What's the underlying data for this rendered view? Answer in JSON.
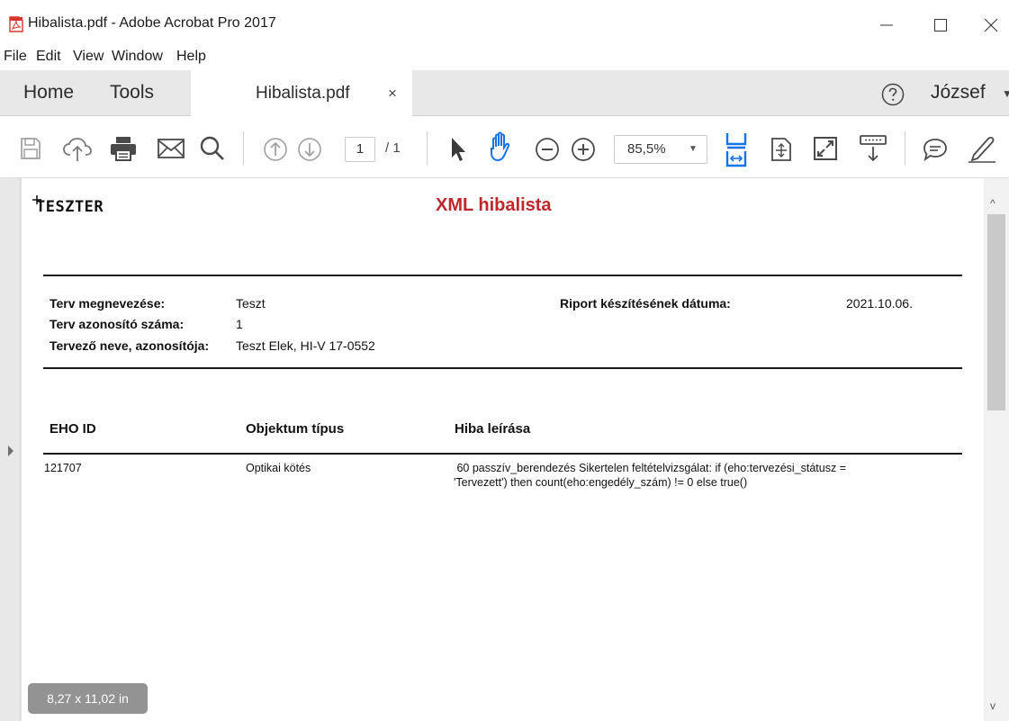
{
  "window": {
    "title": "Hibalista.pdf - Adobe Acrobat Pro 2017"
  },
  "menu": {
    "items": [
      "File",
      "Edit",
      "View",
      "Window",
      "Help"
    ]
  },
  "tabs": {
    "home": "Home",
    "tools": "Tools",
    "document": "Hibalista.pdf",
    "close": "×",
    "user": "József"
  },
  "toolbar": {
    "page_current": "1",
    "page_total": "/ 1",
    "zoom": "85,5%"
  },
  "document": {
    "logo_text": "TESZTER",
    "title": "XML hibalista",
    "fields": {
      "plan_name_label": "Terv megnevezése:",
      "plan_name_value": "Teszt",
      "plan_id_label": "Terv azonosító száma:",
      "plan_id_value": "1",
      "designer_label": "Tervező neve, azonosítója:",
      "designer_value": "Teszt Elek, HI-V 17-0552",
      "report_date_label": "Riport készítésének dátuma:",
      "report_date_value": "2021.10.06."
    },
    "table": {
      "headers": [
        "EHO ID",
        "Objektum típus",
        "Hiba leírása"
      ],
      "rows": [
        {
          "id": "121707",
          "type": "Optikai kötés",
          "desc_line1": " 60 passzív_berendezés Sikertelen feltételvizsgálat: if (eho:tervezési_státusz =",
          "desc_line2": "'Tervezett') then count(eho:engedély_szám) != 0 else true()"
        }
      ]
    }
  },
  "status": {
    "page_size": "8,27 x 11,02 in"
  },
  "colors": {
    "accent_blue": "#1473e6",
    "title_red": "#c0272d",
    "icon_gray": "#6e6e6e"
  }
}
